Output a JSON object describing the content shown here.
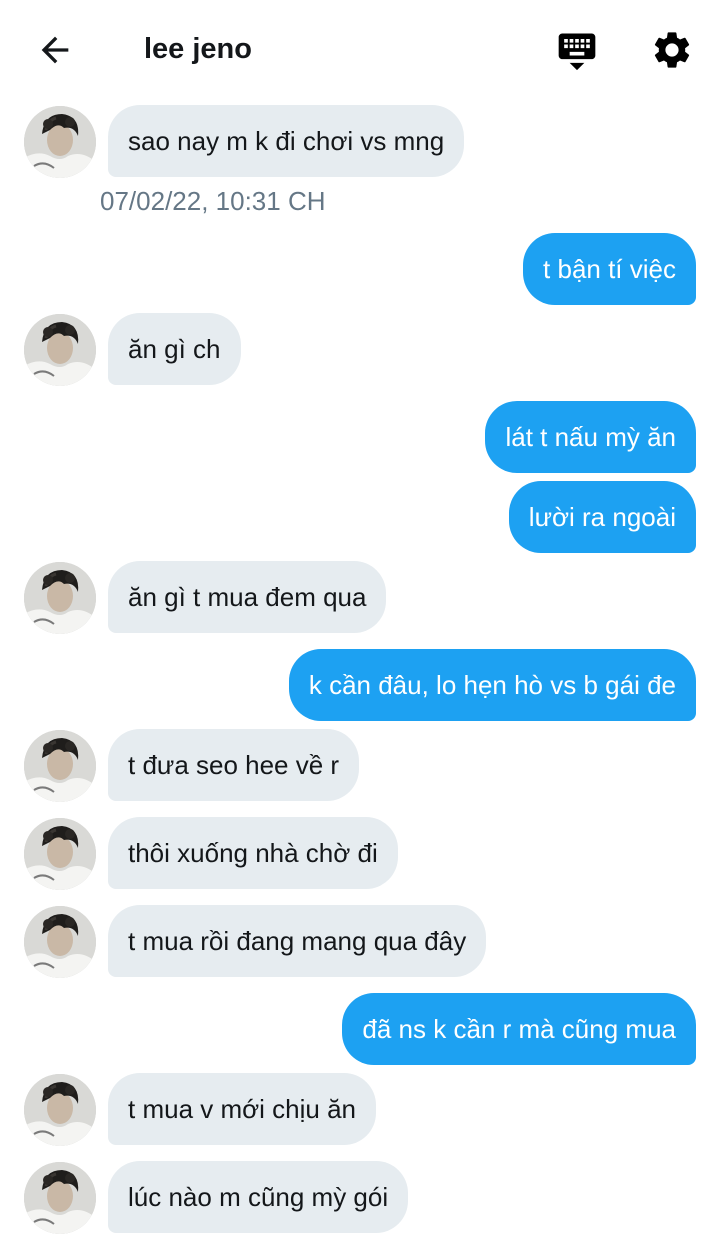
{
  "header": {
    "title": "lee jeno"
  },
  "timestamp": "07/02/22, 10:31 CH",
  "messages": [
    {
      "text": "sao nay m k đi chơi vs mng",
      "from": "them"
    },
    {
      "text": "t bận tí việc",
      "from": "me"
    },
    {
      "text": "ăn gì ch",
      "from": "them"
    },
    {
      "text": "lát t nấu mỳ ăn",
      "from": "me"
    },
    {
      "text": "lười ra ngoài",
      "from": "me"
    },
    {
      "text": "ăn gì t mua đem qua",
      "from": "them"
    },
    {
      "text": "k cần đâu, lo hẹn hò vs b gái đe",
      "from": "me"
    },
    {
      "text": "t đưa seo hee về r",
      "from": "them"
    },
    {
      "text": "thôi xuống nhà chờ đi",
      "from": "them"
    },
    {
      "text": "t mua rồi đang mang qua đây",
      "from": "them"
    },
    {
      "text": "đã ns k cần r mà cũng mua",
      "from": "me"
    },
    {
      "text": "t mua v mới chịu ăn",
      "from": "them"
    },
    {
      "text": "lúc nào m cũng mỳ gói",
      "from": "them"
    }
  ],
  "icons": {
    "back": "arrow-left-icon",
    "keyboard": "keyboard-icon",
    "settings": "gear-icon",
    "avatar": "avatar"
  },
  "colors": {
    "outgoing_bubble": "#1da1f2",
    "incoming_bubble": "#e6ecf0",
    "timestamp": "#657786"
  }
}
